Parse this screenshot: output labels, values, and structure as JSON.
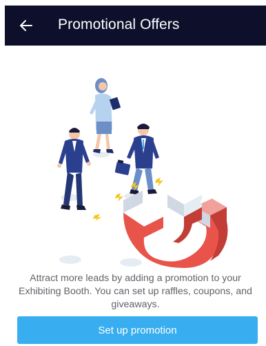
{
  "header": {
    "title": "Promotional Offers",
    "back_icon": "back-arrow-icon"
  },
  "main": {
    "description": "Attract more leads by adding a promotion to your Exhibiting Booth. You can set up raffles, coupons, and giveaways.",
    "cta_label": "Set up promotion"
  },
  "colors": {
    "header_bg": "#0d0f2b",
    "accent": "#38aef0",
    "magnet": "#e8534a"
  }
}
